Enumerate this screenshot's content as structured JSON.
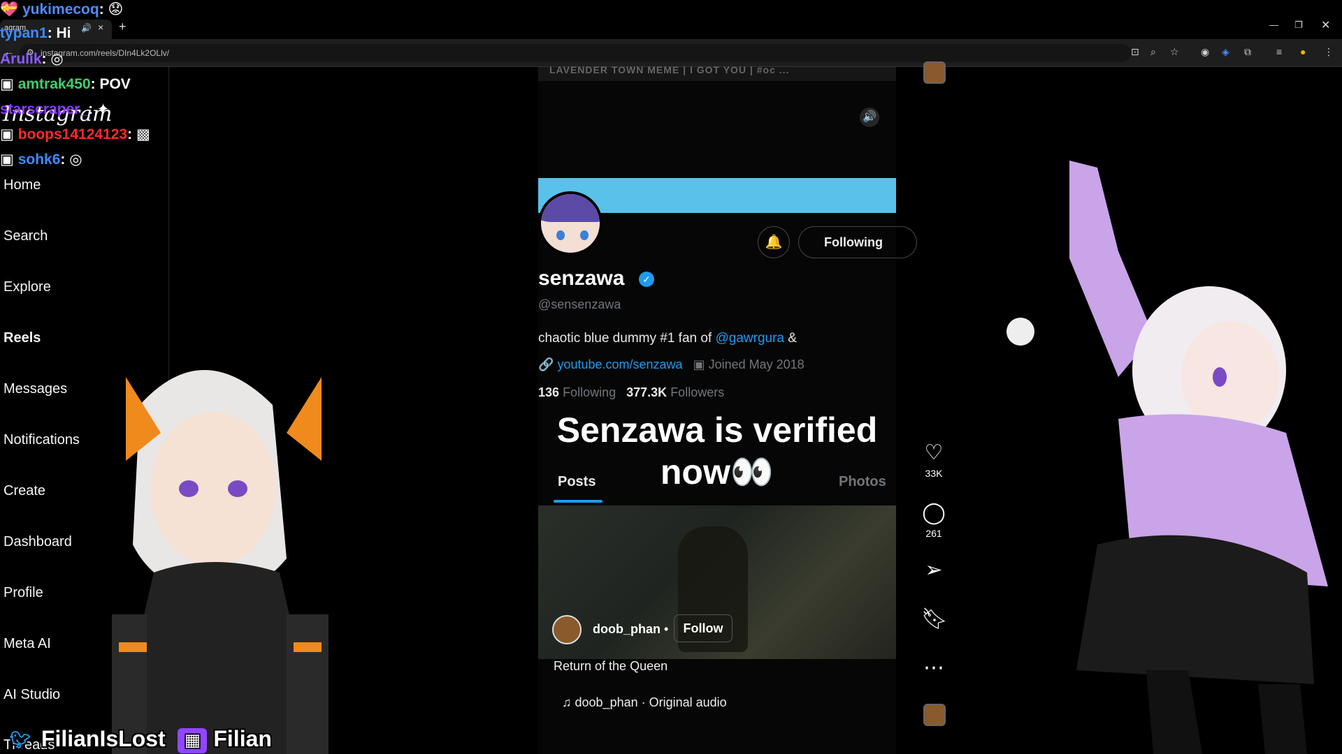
{
  "browser": {
    "tab_title": "agram",
    "url": "instagram.com/reels/DIn4Lk2OLlv/"
  },
  "sidebar": {
    "logo": "Instagram",
    "items": [
      {
        "label": "Home"
      },
      {
        "label": "Search"
      },
      {
        "label": "Explore"
      },
      {
        "label": "Reels",
        "active": true
      },
      {
        "label": "Messages"
      },
      {
        "label": "Notifications"
      },
      {
        "label": "Create"
      },
      {
        "label": "Dashboard"
      },
      {
        "label": "Profile"
      },
      {
        "label": "Meta AI"
      },
      {
        "label": "AI Studio"
      },
      {
        "label": "Threads"
      }
    ]
  },
  "reel": {
    "prev_caption": "LAVENDER TOWN MEME | I GOT YOU | #oc ...",
    "profile_name": "senzawa",
    "handle": "@sensenzawa",
    "bio_prefix": "chaotic blue dummy #1 fan of ",
    "bio_link": "@gawrgura",
    "bio_suffix": " &",
    "website": "youtube.com/senzawa",
    "joined": "Joined May 2018",
    "following_count": "136",
    "following_label": "Following",
    "followers_count": "377.3K",
    "followers_label": "Followers",
    "following_button": "Following",
    "overlay_line1": "Senzawa is verified",
    "overlay_line2": "now👀",
    "tabs": [
      {
        "label": "Posts"
      },
      {
        "label": "Photos"
      }
    ],
    "creator": "doob_phan",
    "follow_button": "Follow",
    "caption": "Return of the Queen",
    "audio": "doob_phan · Original audio"
  },
  "actions": {
    "likes": "33K",
    "comments": "261"
  },
  "chat": [
    {
      "user": "yukimecoq",
      "message": "😟",
      "color": "#4f8cff"
    },
    {
      "user": "typan1",
      "message": "Hi",
      "color": "#3d8bff"
    },
    {
      "user": "Arulik",
      "message": "",
      "color": "#8a5cff"
    },
    {
      "user": "amtrak450",
      "message": "POV",
      "color": "#3ecf6b"
    },
    {
      "user": "starscraper_",
      "message": "",
      "color": "#8a3dff"
    },
    {
      "user": "boops14124123",
      "message": "",
      "color": "#ff2a2a"
    },
    {
      "user": "sohk6",
      "message": "",
      "color": "#3d8bff"
    }
  ],
  "social": {
    "twitter": "FilianIsLost",
    "twitch": "Filian",
    "twitter_color": "#1d9bf0",
    "twitch_color": "#9146ff"
  }
}
